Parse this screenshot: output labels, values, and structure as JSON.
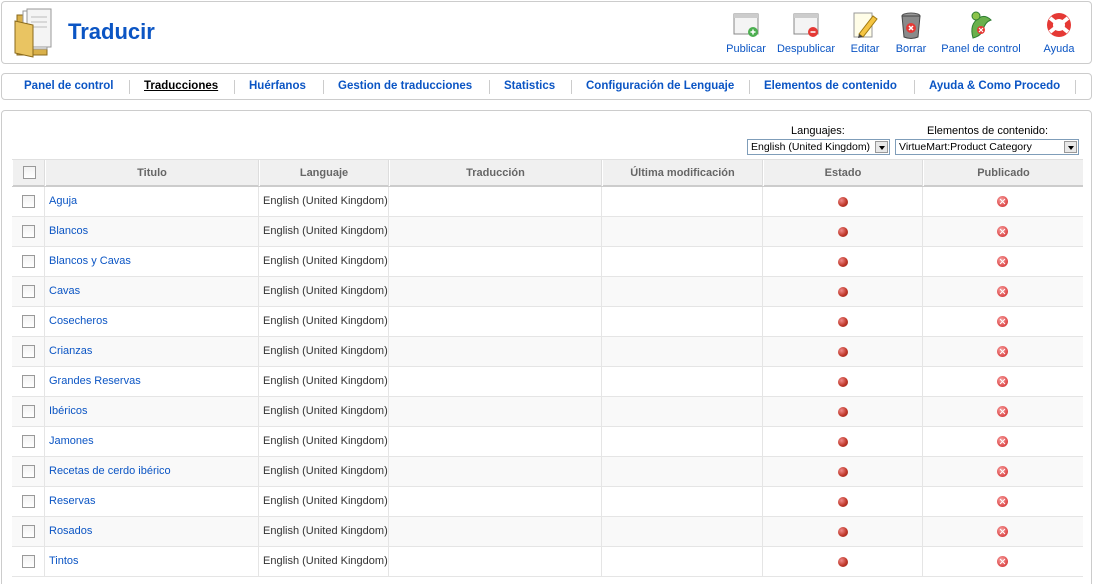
{
  "header": {
    "title": "Traducir"
  },
  "toolbar": [
    {
      "label": "Publicar",
      "icon": "publish-icon"
    },
    {
      "label": "Despublicar",
      "icon": "unpublish-icon"
    },
    {
      "label": "Editar",
      "icon": "edit-icon"
    },
    {
      "label": "Borrar",
      "icon": "trash-icon"
    },
    {
      "label": "Panel de control",
      "icon": "control-panel-icon"
    },
    {
      "label": "Ayuda",
      "icon": "help-icon"
    }
  ],
  "submenu": [
    {
      "label": "Panel de control"
    },
    {
      "label": "Traducciones",
      "active": true
    },
    {
      "label": "Huérfanos"
    },
    {
      "label": "Gestion de traducciones"
    },
    {
      "label": "Statistics"
    },
    {
      "label": "Configuración de Lenguaje"
    },
    {
      "label": "Elementos de contenido"
    },
    {
      "label": "Ayuda & Como Procedo"
    }
  ],
  "filters": {
    "language_label": "Languajes:",
    "language_value": "English (United Kingdom)",
    "content_label": "Elementos de contenido:",
    "content_value": "VirtueMart:Product Category"
  },
  "table": {
    "columns": [
      "Titulo",
      "Languaje",
      "Traducción",
      "Última modificación",
      "Estado",
      "Publicado"
    ],
    "rows": [
      {
        "title": "Aguja",
        "language": "English (United Kingdom)"
      },
      {
        "title": "Blancos",
        "language": "English (United Kingdom)"
      },
      {
        "title": "Blancos y Cavas",
        "language": "English (United Kingdom)"
      },
      {
        "title": "Cavas",
        "language": "English (United Kingdom)"
      },
      {
        "title": "Cosecheros",
        "language": "English (United Kingdom)"
      },
      {
        "title": "Crianzas",
        "language": "English (United Kingdom)"
      },
      {
        "title": "Grandes Reservas",
        "language": "English (United Kingdom)"
      },
      {
        "title": "Ibéricos",
        "language": "English (United Kingdom)"
      },
      {
        "title": "Jamones",
        "language": "English (United Kingdom)"
      },
      {
        "title": "Recetas de cerdo ibérico",
        "language": "English (United Kingdom)"
      },
      {
        "title": "Reservas",
        "language": "English (United Kingdom)"
      },
      {
        "title": "Rosados",
        "language": "English (United Kingdom)"
      },
      {
        "title": "Tintos",
        "language": "English (United Kingdom)"
      }
    ]
  },
  "colors": {
    "link": "#0b55c4",
    "status": "#c0392b",
    "unpublished": "#e05252"
  }
}
